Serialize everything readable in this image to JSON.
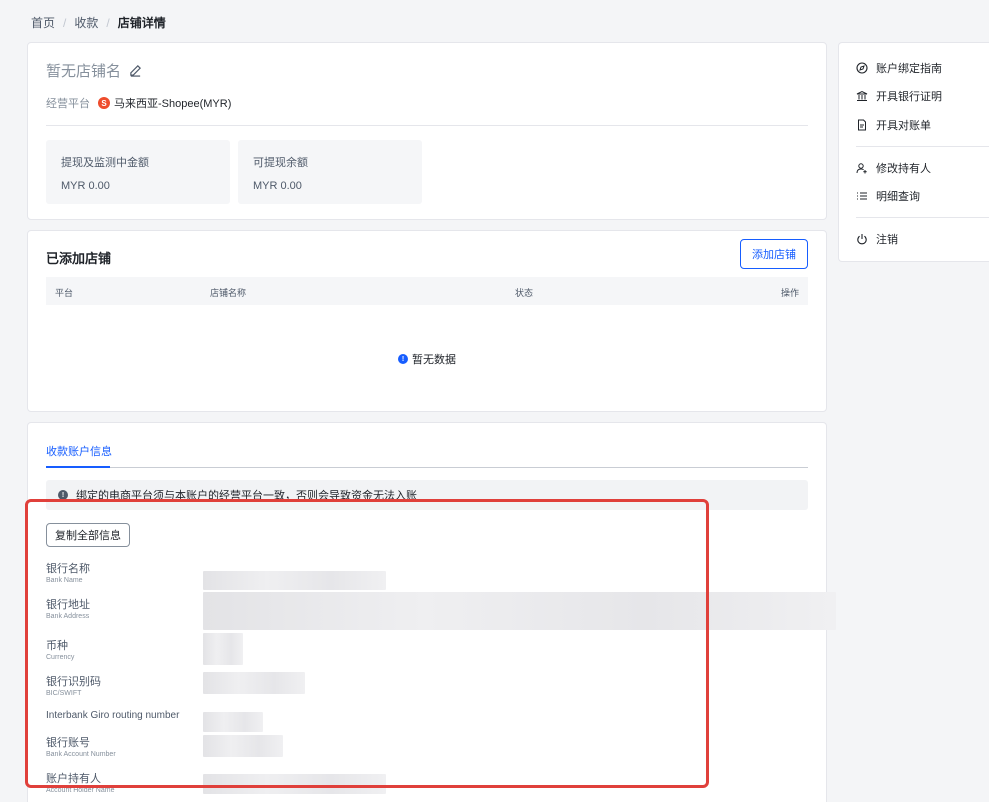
{
  "breadcrumb": {
    "home": "首页",
    "receive": "收款",
    "current": "店铺详情"
  },
  "store": {
    "name": "暂无店铺名",
    "platform_label": "经营平台",
    "platform_badge": "S",
    "platform_value": "马来西亚-Shopee(MYR)",
    "balances": [
      {
        "label": "提现及监测中金额",
        "amount": "MYR 0.00"
      },
      {
        "label": "可提现余额",
        "amount": "MYR 0.00"
      }
    ]
  },
  "shops": {
    "title": "已添加店铺",
    "add_button": "添加店铺",
    "columns": [
      "平台",
      "店铺名称",
      "状态",
      "操作"
    ],
    "empty_text": "暂无数据"
  },
  "account": {
    "tab": "收款账户信息",
    "notice": "绑定的电商平台须与本账户的经营平台一致，否则会导致资金无法入账",
    "copy_button": "复制全部信息",
    "fields": [
      {
        "cn": "银行名称",
        "en": "Bank Name"
      },
      {
        "cn": "银行地址",
        "en": "Bank Address"
      },
      {
        "cn": "币种",
        "en": "Currency"
      },
      {
        "cn": "银行识别码",
        "en": "BIC/SWIFT"
      },
      {
        "full": "Interbank Giro routing number"
      },
      {
        "cn": "银行账号",
        "en": "Bank Account Number"
      },
      {
        "cn": "账户持有人",
        "en": "Account Holder Name"
      }
    ]
  },
  "menu": {
    "items": [
      {
        "label": "账户绑定指南",
        "icon": "compass-icon"
      },
      {
        "label": "开具银行证明",
        "icon": "bank-icon"
      },
      {
        "label": "开具对账单",
        "icon": "document-icon"
      },
      {
        "label": "修改持有人",
        "icon": "user-add-icon"
      },
      {
        "label": "明细查询",
        "icon": "list-icon"
      },
      {
        "label": "注销",
        "icon": "power-icon"
      }
    ]
  },
  "colors": {
    "primary": "#165dff",
    "highlight": "#e0403b",
    "shopee": "#ee4d2d"
  }
}
